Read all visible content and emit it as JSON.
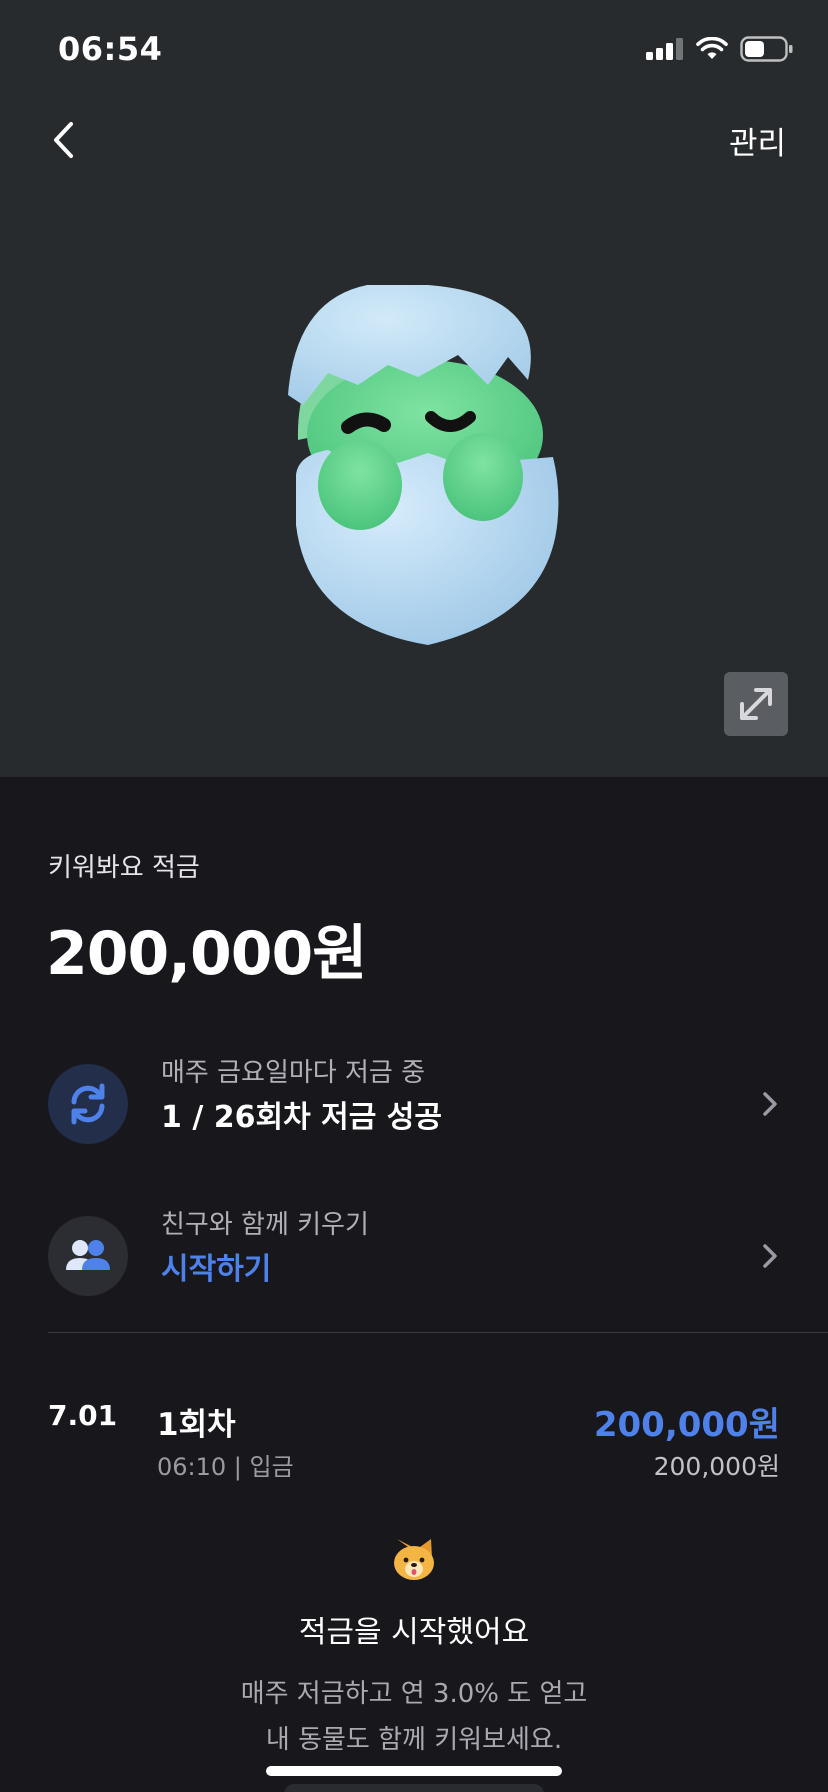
{
  "status_bar": {
    "time": "06:54",
    "battery_level": 0.5
  },
  "nav": {
    "manage_label": "관리"
  },
  "account": {
    "name": "키워봐요 적금",
    "balance": "200,000원"
  },
  "schedule_row": {
    "sub": "매주 금요일마다 저금 중",
    "main": "1 / 26회차 저금 성공"
  },
  "friend_row": {
    "sub": "친구와 함께 키우기",
    "main": "시작하기"
  },
  "transactions": [
    {
      "date": "7.01",
      "title": "1회차",
      "meta": "06:10 | 입금",
      "amount": "200,000원",
      "balance": "200,000원"
    }
  ],
  "notice": {
    "title": "적금을 시작했어요",
    "line1": "매주 저금하고 연 3.0% 도 얻고",
    "line2": "내 동물도 함께 키워보세요."
  },
  "colors": {
    "accent": "#4e82ea",
    "hero_bg": "#272b2d",
    "page_bg": "#17171c"
  }
}
